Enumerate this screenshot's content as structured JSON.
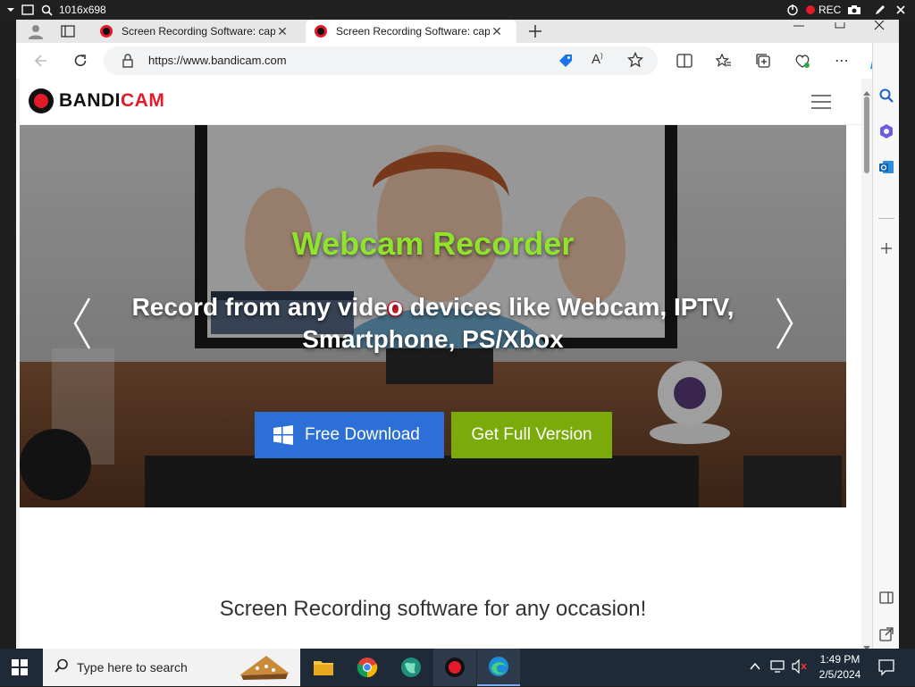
{
  "recorder": {
    "resolution": "1016x698",
    "rec_label": "REC"
  },
  "browser": {
    "tabs": [
      {
        "title": "Screen Recording Software: capt",
        "active": false
      },
      {
        "title": "Screen Recording Software: capt",
        "active": true
      }
    ],
    "url": "https://www.bandicam.com"
  },
  "site": {
    "logo_text_1": "BANDI",
    "logo_text_2": "CAM",
    "hero": {
      "title": "Webcam Recorder",
      "subtitle_line1": "Record from any video devices like Webcam, IPTV,",
      "subtitle_line2": "Smartphone, PS/Xbox",
      "primary_cta": "Free Download",
      "secondary_cta": "Get Full Version"
    },
    "section_heading": "Screen Recording software for any occasion!"
  },
  "taskbar": {
    "search_placeholder": "Type here to search",
    "time": "1:49 PM",
    "date": "2/5/2024"
  },
  "colors": {
    "bandicam_red": "#e21b2b",
    "hero_title_green": "#8fe32a",
    "download_blue": "#2c6fd7",
    "full_version_green": "#7aab0a",
    "taskbar_bg": "#1f2a38"
  }
}
